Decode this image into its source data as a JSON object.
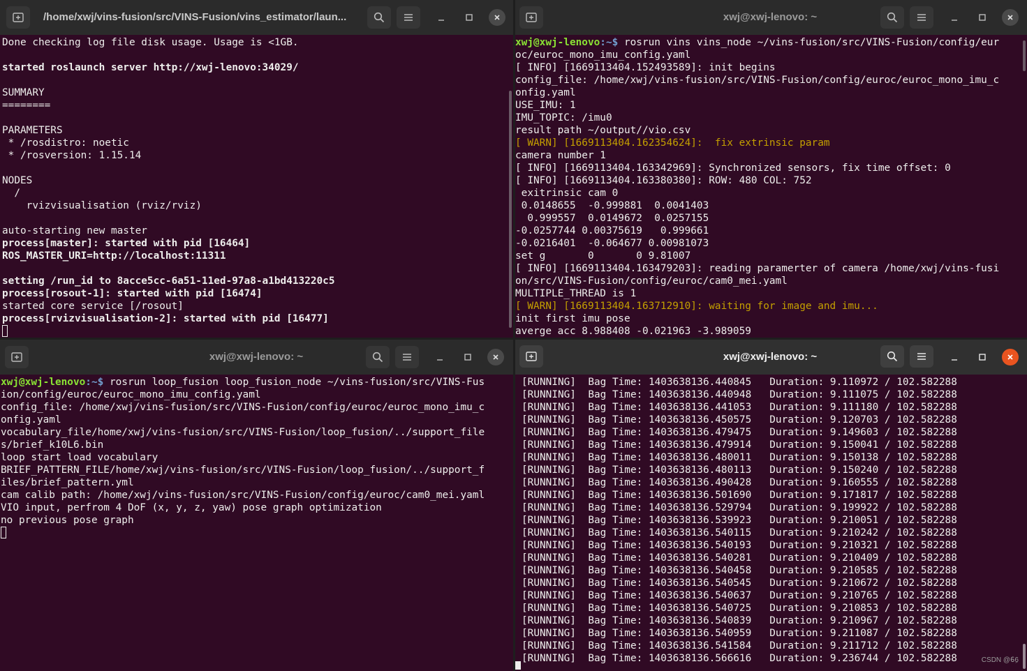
{
  "windows": {
    "top_left": {
      "title": "/home/xwj/vins-fusion/src/VINS-Fusion/vins_estimator/laun...",
      "lines": [
        {
          "t": "Done checking log file disk usage. Usage is <1GB.",
          "c": ""
        },
        {
          "t": "",
          "c": ""
        },
        {
          "t": "started roslaunch server http://xwj-lenovo:34029/",
          "c": "b"
        },
        {
          "t": "",
          "c": ""
        },
        {
          "t": "SUMMARY",
          "c": ""
        },
        {
          "t": "========",
          "c": ""
        },
        {
          "t": "",
          "c": ""
        },
        {
          "t": "PARAMETERS",
          "c": ""
        },
        {
          "t": " * /rosdistro: noetic",
          "c": ""
        },
        {
          "t": " * /rosversion: 1.15.14",
          "c": ""
        },
        {
          "t": "",
          "c": ""
        },
        {
          "t": "NODES",
          "c": ""
        },
        {
          "t": "  /",
          "c": ""
        },
        {
          "t": "    rvizvisualisation (rviz/rviz)",
          "c": ""
        },
        {
          "t": "",
          "c": ""
        },
        {
          "t": "auto-starting new master",
          "c": ""
        },
        {
          "t": "process[master]: started with pid [16464]",
          "c": "b"
        },
        {
          "t": "ROS_MASTER_URI=http://localhost:11311",
          "c": "b"
        },
        {
          "t": "",
          "c": ""
        },
        {
          "t": "setting /run_id to 8acce5cc-6a51-11ed-97a8-a1bd413220c5",
          "c": "b"
        },
        {
          "t": "process[rosout-1]: started with pid [16474]",
          "c": "b"
        },
        {
          "t": "started core service [/rosout]",
          "c": ""
        },
        {
          "t": "process[rvizvisualisation-2]: started with pid [16477]",
          "c": "b"
        }
      ]
    },
    "top_right": {
      "title": "xwj@xwj-lenovo: ~",
      "prompt_user": "xwj@xwj-lenovo",
      "prompt_path": ":~$",
      "command": " rosrun vins vins_node ~/vins-fusion/src/VINS-Fusion/config/eur",
      "lines": [
        {
          "t": "oc/euroc_mono_imu_config.yaml",
          "c": ""
        },
        {
          "t": "[ INFO] [1669113404.152493589]: init begins",
          "c": ""
        },
        {
          "t": "config_file: /home/xwj/vins-fusion/src/VINS-Fusion/config/euroc/euroc_mono_imu_c",
          "c": ""
        },
        {
          "t": "onfig.yaml",
          "c": ""
        },
        {
          "t": "USE_IMU: 1",
          "c": ""
        },
        {
          "t": "IMU_TOPIC: /imu0",
          "c": ""
        },
        {
          "t": "result path ~/output//vio.csv",
          "c": ""
        },
        {
          "t": "[ WARN] [1669113404.162354624]:  fix extrinsic param",
          "c": "warn"
        },
        {
          "t": "camera number 1",
          "c": ""
        },
        {
          "t": "[ INFO] [1669113404.163342969]: Synchronized sensors, fix time offset: 0",
          "c": ""
        },
        {
          "t": "[ INFO] [1669113404.163380380]: ROW: 480 COL: 752",
          "c": ""
        },
        {
          "t": " exitrinsic cam 0",
          "c": ""
        },
        {
          "t": " 0.0148655  -0.999881  0.0041403",
          "c": ""
        },
        {
          "t": "  0.999557  0.0149672  0.0257155",
          "c": ""
        },
        {
          "t": "-0.0257744 0.00375619   0.999661",
          "c": ""
        },
        {
          "t": "-0.0216401  -0.064677 0.00981073",
          "c": ""
        },
        {
          "t": "set g       0       0 9.81007",
          "c": ""
        },
        {
          "t": "[ INFO] [1669113404.163479203]: reading paramerter of camera /home/xwj/vins-fusi",
          "c": ""
        },
        {
          "t": "on/src/VINS-Fusion/config/euroc/cam0_mei.yaml",
          "c": ""
        },
        {
          "t": "MULTIPLE_THREAD is 1",
          "c": ""
        },
        {
          "t": "[ WARN] [1669113404.163712910]: waiting for image and imu...",
          "c": "warn"
        },
        {
          "t": "init first imu pose",
          "c": ""
        },
        {
          "t": "averge acc 8.988408 -0.021963 -3.989059",
          "c": ""
        }
      ]
    },
    "bottom_left": {
      "title": "xwj@xwj-lenovo: ~",
      "prompt_user": "xwj@xwj-lenovo",
      "prompt_path": ":~$",
      "command": " rosrun loop_fusion loop_fusion_node ~/vins-fusion/src/VINS-Fus",
      "lines": [
        {
          "t": "ion/config/euroc/euroc_mono_imu_config.yaml",
          "c": ""
        },
        {
          "t": "config_file: /home/xwj/vins-fusion/src/VINS-Fusion/config/euroc/euroc_mono_imu_c",
          "c": ""
        },
        {
          "t": "onfig.yaml",
          "c": ""
        },
        {
          "t": "vocabulary_file/home/xwj/vins-fusion/src/VINS-Fusion/loop_fusion/../support_file",
          "c": ""
        },
        {
          "t": "s/brief_k10L6.bin",
          "c": ""
        },
        {
          "t": "loop start load vocabulary",
          "c": ""
        },
        {
          "t": "BRIEF_PATTERN_FILE/home/xwj/vins-fusion/src/VINS-Fusion/loop_fusion/../support_f",
          "c": ""
        },
        {
          "t": "iles/brief_pattern.yml",
          "c": ""
        },
        {
          "t": "cam calib path: /home/xwj/vins-fusion/src/VINS-Fusion/config/euroc/cam0_mei.yaml",
          "c": ""
        },
        {
          "t": "VIO input, perfrom 4 DoF (x, y, z, yaw) pose graph optimization",
          "c": ""
        },
        {
          "t": "no previous pose graph",
          "c": ""
        }
      ]
    },
    "bottom_right": {
      "title": "xwj@xwj-lenovo: ~",
      "status_label": "[RUNNING]",
      "bag_label": "Bag Time:",
      "duration_label": "Duration:",
      "total": "102.582288",
      "rows": [
        {
          "bag": "1403638136.440845",
          "dur": "9.110972"
        },
        {
          "bag": "1403638136.440948",
          "dur": "9.111075"
        },
        {
          "bag": "1403638136.441053",
          "dur": "9.111180"
        },
        {
          "bag": "1403638136.450575",
          "dur": "9.120703"
        },
        {
          "bag": "1403638136.479475",
          "dur": "9.149603"
        },
        {
          "bag": "1403638136.479914",
          "dur": "9.150041"
        },
        {
          "bag": "1403638136.480011",
          "dur": "9.150138"
        },
        {
          "bag": "1403638136.480113",
          "dur": "9.150240"
        },
        {
          "bag": "1403638136.490428",
          "dur": "9.160555"
        },
        {
          "bag": "1403638136.501690",
          "dur": "9.171817"
        },
        {
          "bag": "1403638136.529794",
          "dur": "9.199922"
        },
        {
          "bag": "1403638136.539923",
          "dur": "9.210051"
        },
        {
          "bag": "1403638136.540115",
          "dur": "9.210242"
        },
        {
          "bag": "1403638136.540193",
          "dur": "9.210321"
        },
        {
          "bag": "1403638136.540281",
          "dur": "9.210409"
        },
        {
          "bag": "1403638136.540458",
          "dur": "9.210585"
        },
        {
          "bag": "1403638136.540545",
          "dur": "9.210672"
        },
        {
          "bag": "1403638136.540637",
          "dur": "9.210765"
        },
        {
          "bag": "1403638136.540725",
          "dur": "9.210853"
        },
        {
          "bag": "1403638136.540839",
          "dur": "9.210967"
        },
        {
          "bag": "1403638136.540959",
          "dur": "9.211087"
        },
        {
          "bag": "1403638136.541584",
          "dur": "9.211712"
        },
        {
          "bag": "1403638136.566616",
          "dur": "9.236744"
        }
      ]
    }
  },
  "watermark": "CSDN @6ِ6"
}
